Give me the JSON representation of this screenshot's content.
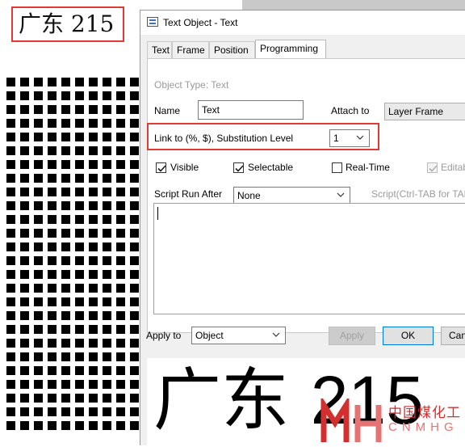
{
  "canvas": {
    "heading": "广东 215"
  },
  "dialog": {
    "title": "Text Object - Text",
    "tabs": [
      {
        "label": "Text"
      },
      {
        "label": "Frame"
      },
      {
        "label": "Position"
      },
      {
        "label": "Programming"
      }
    ],
    "object_type": "Object Type: Text",
    "name_label": "Name",
    "name_value": "Text",
    "attach_label": "Attach to",
    "attach_value": "Layer Frame",
    "link_label": "Link to (%, $), Substitution Level",
    "link_value": "1",
    "checkboxes": [
      {
        "label": "Visible",
        "checked": true
      },
      {
        "label": "Selectable",
        "checked": true
      },
      {
        "label": "Real-Time",
        "checked": false
      },
      {
        "label": "Editab",
        "checked": true,
        "disabled": true
      }
    ],
    "script_run_label": "Script Run After",
    "script_run_value": "None",
    "script_hint": "Script(Ctrl-TAB for TAB",
    "apply_to_label": "Apply to",
    "apply_to_value": "Object",
    "apply_button": "Apply",
    "ok_button": "OK",
    "cancel_button": "Can",
    "preview_text_cn": "广东",
    "preview_text_num": "215"
  },
  "watermark": {
    "brand_cn": "中国煤化工",
    "brand_en": "CNMHG"
  },
  "colors": {
    "highlight": "#e53935",
    "checkbox_check": "#1a1a1a",
    "default_button_border": "#0078d7",
    "watermark": "#d32f2f"
  }
}
